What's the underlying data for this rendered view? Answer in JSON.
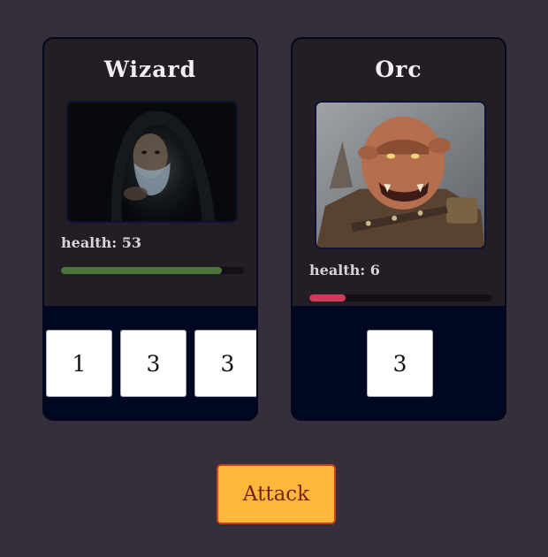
{
  "hero": {
    "name": "Wizard",
    "health_label": "health: 53",
    "health_fraction": 0.88,
    "health_color": "#4a7537",
    "dice": [
      "1",
      "3",
      "3"
    ]
  },
  "enemy": {
    "name": "Orc",
    "health_label": "health: 6",
    "health_fraction": 0.2,
    "health_color": "#cf3a5b",
    "dice": [
      "3"
    ]
  },
  "actions": {
    "attack_label": "Attack"
  }
}
